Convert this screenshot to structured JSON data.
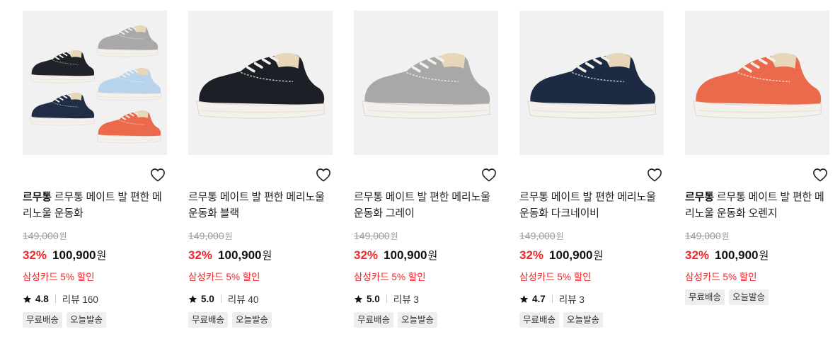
{
  "products": [
    {
      "brand": "르무통",
      "title": "르무통 메이트 발 편한 메리노울 운동화",
      "original_price": "149,000",
      "original_unit": "원",
      "discount_rate": "32%",
      "sale_price": "100,900",
      "sale_unit": "원",
      "card_discount": "삼성카드 5% 할인",
      "rating": "4.8",
      "review_label": "리뷰 160",
      "tags": [
        "무료배송",
        "오늘발송"
      ],
      "image_kind": "multi",
      "shoe_colors": [
        "#1f2228",
        "#a9a9a9",
        "#b8d3ec",
        "#1f2d46",
        "#ec6a4c"
      ]
    },
    {
      "brand": "",
      "title": "르무통 메이트 발 편한 메리노울 운동화 블랙",
      "original_price": "149,000",
      "original_unit": "원",
      "discount_rate": "32%",
      "sale_price": "100,900",
      "sale_unit": "원",
      "card_discount": "삼성카드 5% 할인",
      "rating": "5.0",
      "review_label": "리뷰 40",
      "tags": [
        "무료배송",
        "오늘발송"
      ],
      "image_kind": "single",
      "shoe_colors": [
        "#1c1f26"
      ]
    },
    {
      "brand": "",
      "title": "르무통 메이트 발 편한 메리노울 운동화 그레이",
      "original_price": "149,000",
      "original_unit": "원",
      "discount_rate": "32%",
      "sale_price": "100,900",
      "sale_unit": "원",
      "card_discount": "삼성카드 5% 할인",
      "rating": "5.0",
      "review_label": "리뷰 3",
      "tags": [
        "무료배송",
        "오늘발송"
      ],
      "image_kind": "single",
      "shoe_colors": [
        "#a8a8a8"
      ]
    },
    {
      "brand": "",
      "title": "르무통 메이트 발 편한 메리노울 운동화 다크네이비",
      "original_price": "149,000",
      "original_unit": "원",
      "discount_rate": "32%",
      "sale_price": "100,900",
      "sale_unit": "원",
      "card_discount": "삼성카드 5% 할인",
      "rating": "4.7",
      "review_label": "리뷰 3",
      "tags": [
        "무료배송",
        "오늘발송"
      ],
      "image_kind": "single",
      "shoe_colors": [
        "#1d2a44"
      ]
    },
    {
      "brand": "르무통",
      "title": "르무통 메이트 발 편한 메리노울 운동화 오렌지",
      "original_price": "149,000",
      "original_unit": "원",
      "discount_rate": "32%",
      "sale_price": "100,900",
      "sale_unit": "원",
      "card_discount": "삼성카드 5% 할인",
      "rating": "",
      "review_label": "",
      "tags": [
        "무료배송",
        "오늘발송"
      ],
      "image_kind": "single",
      "shoe_colors": [
        "#ec6a4c"
      ]
    }
  ],
  "icons": {
    "wishlist": "heart-outline-icon",
    "rating": "star-icon"
  },
  "colors": {
    "accent_red": "#f0262b",
    "thumb_bg": "#f1f1f1",
    "tag_bg": "#eeeeee"
  }
}
